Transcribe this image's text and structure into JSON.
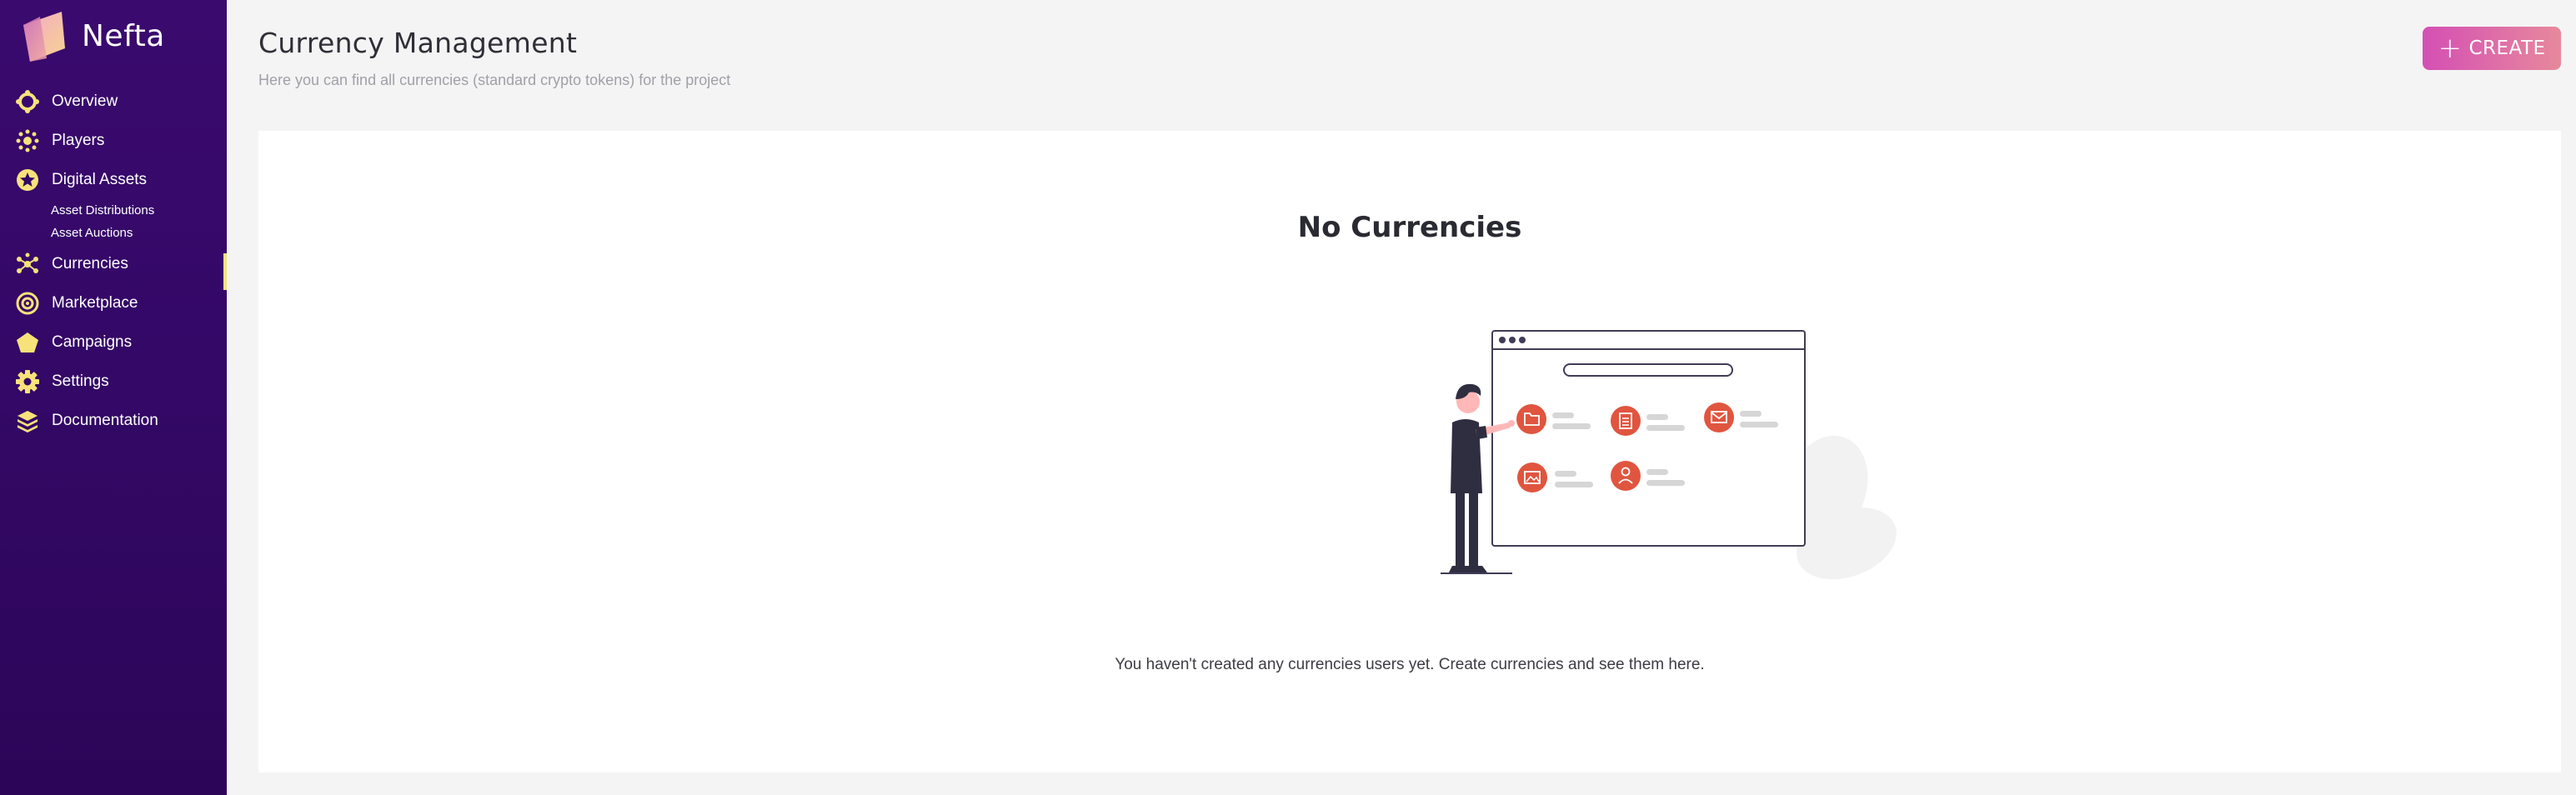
{
  "app": {
    "name": "Nefta"
  },
  "sidebar": {
    "items": [
      {
        "label": "Overview",
        "icon": "overview-icon"
      },
      {
        "label": "Players",
        "icon": "players-icon"
      },
      {
        "label": "Digital Assets",
        "icon": "digital-assets-icon",
        "subitems": [
          {
            "label": "Asset Distributions"
          },
          {
            "label": "Asset Auctions"
          }
        ]
      },
      {
        "label": "Currencies",
        "icon": "currencies-icon",
        "active": true
      },
      {
        "label": "Marketplace",
        "icon": "marketplace-icon"
      },
      {
        "label": "Campaigns",
        "icon": "campaigns-icon"
      },
      {
        "label": "Settings",
        "icon": "settings-icon"
      },
      {
        "label": "Documentation",
        "icon": "documentation-icon"
      }
    ]
  },
  "header": {
    "title": "Currency Management",
    "subtitle": "Here you can find all currencies (standard crypto tokens) for the project",
    "create_label": "CREATE"
  },
  "empty_state": {
    "title": "No Currencies",
    "message": "You haven't created any currencies users yet. Create currencies and see them here."
  },
  "colors": {
    "sidebar_bg": "#330866",
    "icon_yellow": "#f7e27a",
    "accent_start": "#d44fb4",
    "accent_end": "#e7899c",
    "illustration_red": "#e0553f"
  }
}
